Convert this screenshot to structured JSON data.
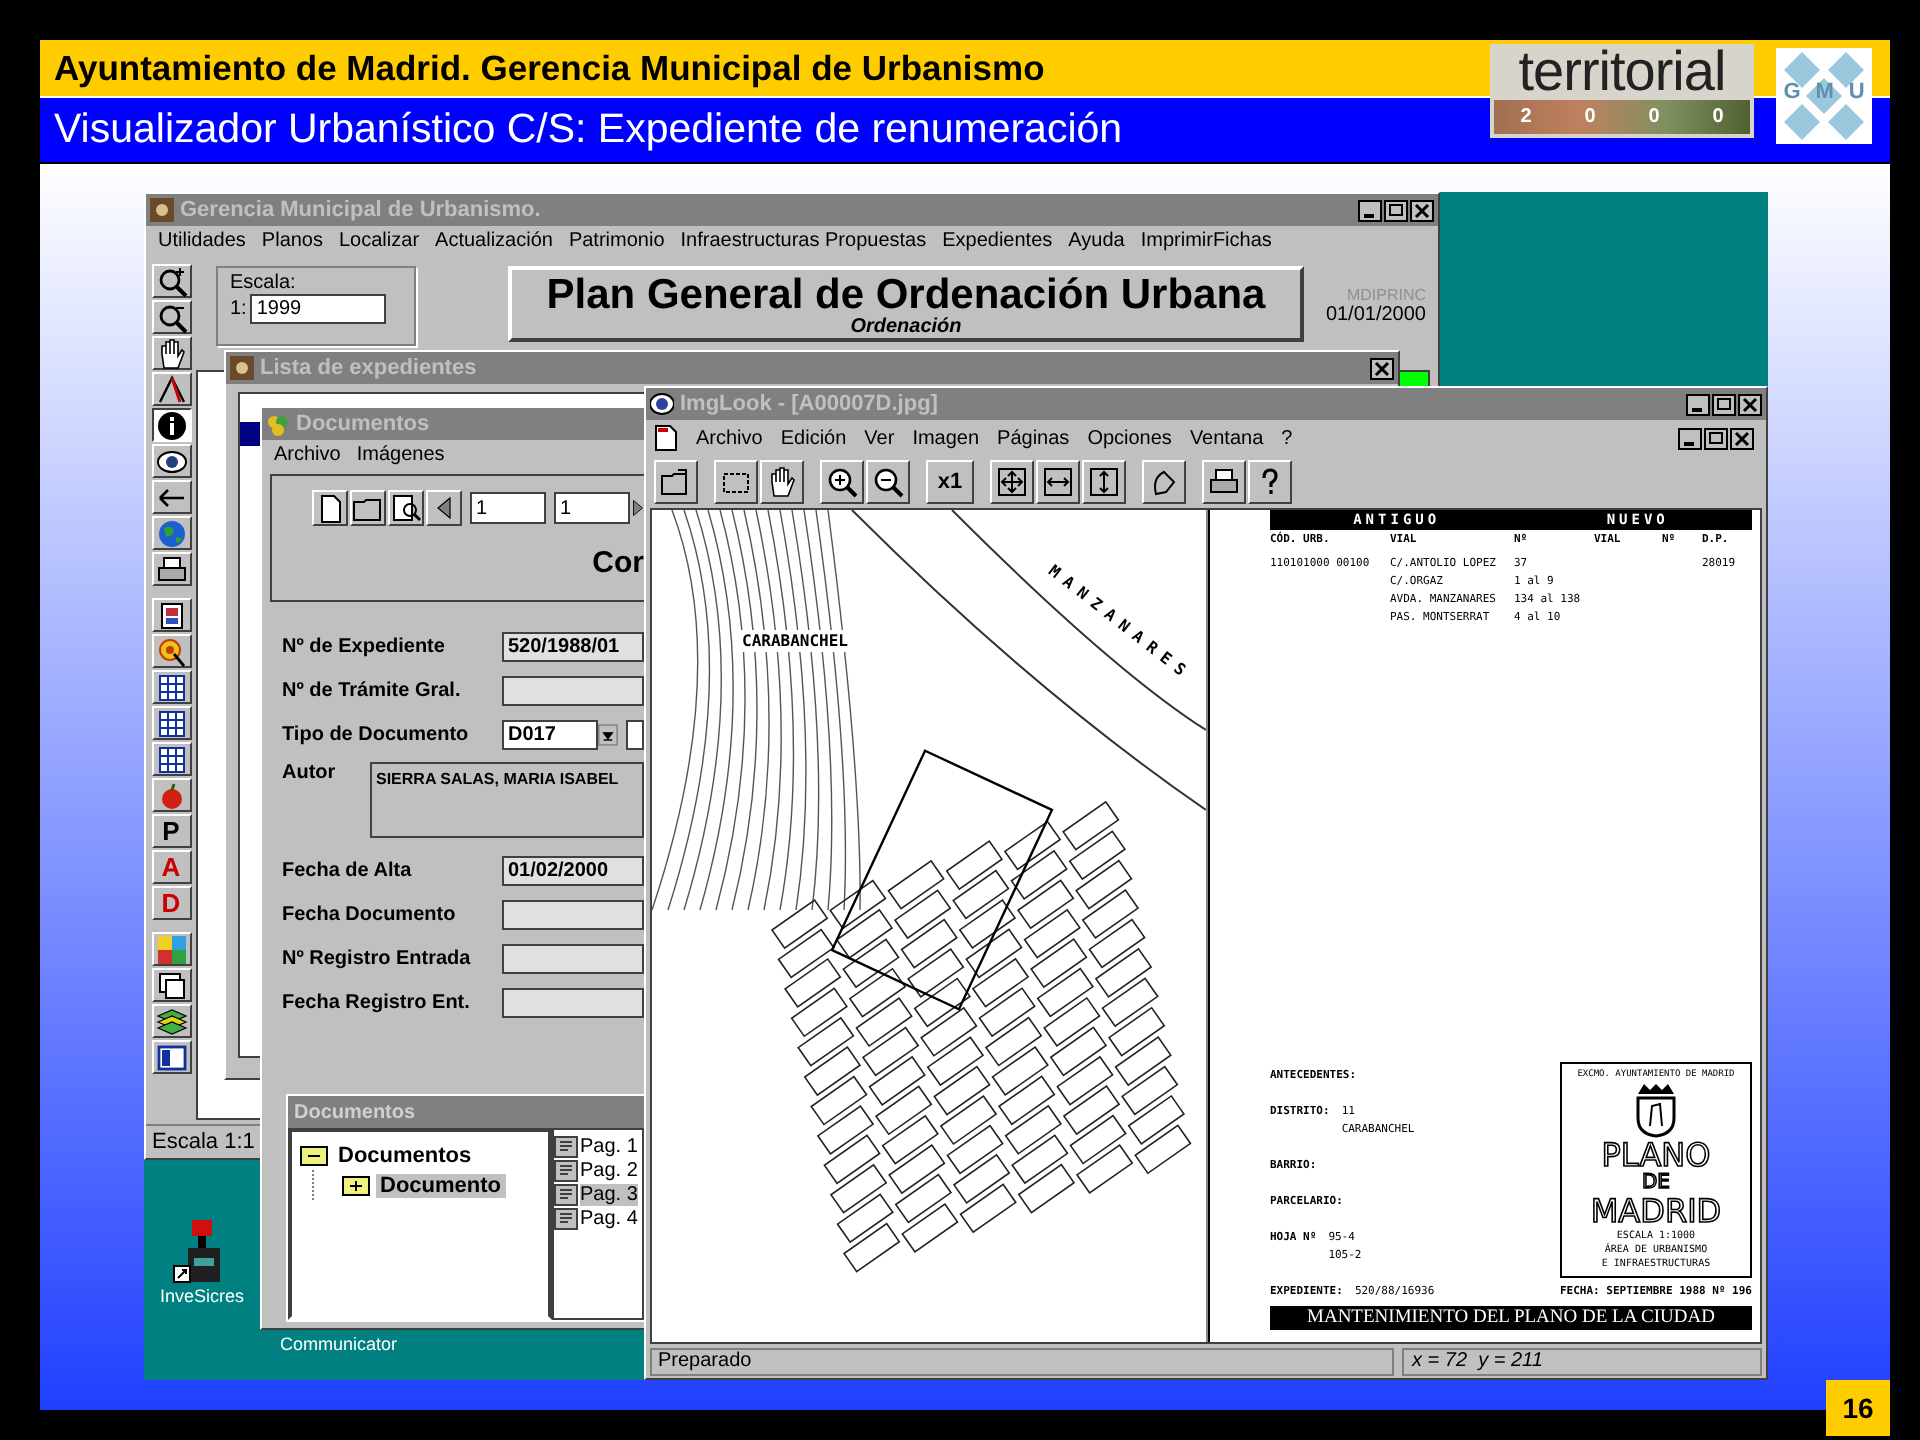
{
  "slide": {
    "title": "Ayuntamiento de Madrid. Gerencia Municipal de Urbanismo",
    "subtitle": "Visualizador Urbanístico C/S: Expediente de renumeración",
    "logo_text": "territorial",
    "logo_year": [
      "2",
      "0",
      "0",
      "0"
    ],
    "logo_letters": [
      "G",
      "M",
      "U"
    ],
    "page_number": "16"
  },
  "main_window": {
    "title": "Gerencia Municipal de Urbanismo.",
    "menu": [
      "Utilidades",
      "Planos",
      "Localizar",
      "Actualización",
      "Patrimonio",
      "Infraestructuras Propuestas",
      "Expedientes",
      "Ayuda",
      "ImprimirFichas"
    ],
    "scale_label": "Escala:",
    "scale_prefix": "1:",
    "scale_value": "1999",
    "banner_title": "Plan General de Ordenación Urbana",
    "banner_subtitle": "Ordenación",
    "module": "MDIPRINC",
    "date": "01/01/2000",
    "toolbar": [
      {
        "kind": "zoom-in",
        "selected": false
      },
      {
        "kind": "zoom-out",
        "selected": false
      },
      {
        "kind": "hand",
        "selected": false
      },
      {
        "kind": "pointer",
        "selected": false
      },
      {
        "kind": "info",
        "selected": true
      },
      {
        "kind": "eye",
        "selected": false
      },
      {
        "kind": "back",
        "selected": false
      },
      {
        "kind": "globe",
        "selected": false
      },
      {
        "kind": "printer",
        "selected": false
      },
      {
        "kind": "stack",
        "selected": false
      },
      {
        "kind": "target",
        "selected": false
      },
      {
        "kind": "grid",
        "selected": false
      },
      {
        "kind": "grid",
        "selected": false
      },
      {
        "kind": "grid",
        "selected": false
      },
      {
        "kind": "apple",
        "selected": false
      },
      {
        "kind": "letter",
        "label": "P",
        "color": "#000000",
        "selected": false
      },
      {
        "kind": "letter",
        "label": "A",
        "color": "#cc0000",
        "selected": false
      },
      {
        "kind": "letter",
        "label": "D",
        "color": "#cc0000",
        "selected": false
      },
      {
        "kind": "palette",
        "selected": false
      },
      {
        "kind": "window",
        "selected": false
      },
      {
        "kind": "layers",
        "selected": false
      },
      {
        "kind": "panel",
        "selected": false
      }
    ],
    "status": "Escala 1:1"
  },
  "list_window": {
    "title": "Lista de expedientes"
  },
  "documents_window": {
    "title": "Documentos",
    "menu": [
      "Archivo",
      "Imágenes"
    ],
    "page_from": "1",
    "page_to": "1",
    "heading": "Cor",
    "fields": [
      {
        "kind": "text",
        "label": "Nº de Expediente",
        "value": "520/1988/01"
      },
      {
        "kind": "text",
        "label": "Nº de Trámite Gral."
      },
      {
        "kind": "combo",
        "label": "Tipo de Documento",
        "value": "D017"
      },
      {
        "kind": "area",
        "label": "Autor",
        "value": "SIERRA SALAS, MARIA ISABEL"
      },
      {
        "kind": "text",
        "label": "Fecha de Alta",
        "value": "01/02/2000"
      },
      {
        "kind": "text",
        "label": "Fecha Documento"
      },
      {
        "kind": "text",
        "label": "Nº Registro Entrada"
      },
      {
        "kind": "text",
        "label": "Fecha Registro Ent."
      }
    ],
    "tree_header": "Documentos",
    "tree": [
      {
        "label": "Documentos",
        "expanded": true,
        "selected": false,
        "children": [
          {
            "label": "Documento",
            "expanded": false,
            "selected": true
          }
        ]
      }
    ],
    "pages": [
      {
        "label": "Pag. 1",
        "selected": false
      },
      {
        "label": "Pag. 2",
        "selected": false
      },
      {
        "label": "Pag. 3",
        "selected": true
      },
      {
        "label": "Pag. 4",
        "selected": false
      }
    ]
  },
  "viewer": {
    "title": "ImgLook - [A00007D.jpg]",
    "menu": [
      "Archivo",
      "Edición",
      "Ver",
      "Imagen",
      "Páginas",
      "Opciones",
      "Ventana",
      "?"
    ],
    "zoom_label": "x1",
    "map_labels": [
      "MANZANARES",
      "CARABANCHEL"
    ],
    "scan": {
      "header": [
        "ANTIGUO",
        "NUEVO"
      ],
      "columns": [
        "CÓD. URB.",
        "VIAL",
        "Nº",
        "VIAL",
        "Nº",
        "D.P."
      ],
      "rows": [
        [
          "110101000 00100",
          "C/.ANTOLIO LOPEZ",
          "37",
          "",
          "",
          "28019"
        ],
        [
          "",
          "C/.ORGAZ",
          "1 al 9",
          "",
          "",
          ""
        ],
        [
          "",
          "AVDA. MANZANARES",
          "134 al 138",
          "",
          "",
          ""
        ],
        [
          "",
          "PAS. MONTSERRAT",
          "4 al 10",
          "",
          "",
          ""
        ]
      ],
      "antecedentes": "ANTECEDENTES:",
      "distrito_label": "DISTRITO:",
      "distrito": [
        "11",
        "CARABANCHEL"
      ],
      "barrio_label": "BARRIO:",
      "parcelario_label": "PARCELARIO:",
      "hoja_label": "HOJA Nº",
      "hoja": [
        "95-4",
        "105-2"
      ],
      "expediente_label": "EXPEDIENTE:",
      "expediente": "520/88/16936",
      "stamp_top": "EXCMO. AYUNTAMIENTO DE MADRID",
      "stamp_title": [
        "PLANO",
        "DE",
        "MADRID"
      ],
      "stamp_scale": "ESCALA 1:1000",
      "stamp_area": [
        "ÁREA DE URBANISMO",
        "E INFRAESTRUCTURAS"
      ],
      "fecha": "FECHA: SEPTIEMBRE 1988",
      "numero": "Nº 196",
      "footer": "MANTENIMIENTO DEL PLANO DE LA CIUDAD"
    },
    "status": "Preparado",
    "coords": "x = 72  y = 211"
  },
  "desktop_icons": [
    {
      "label": "InveSicres"
    },
    {
      "label": "Communicator"
    }
  ]
}
